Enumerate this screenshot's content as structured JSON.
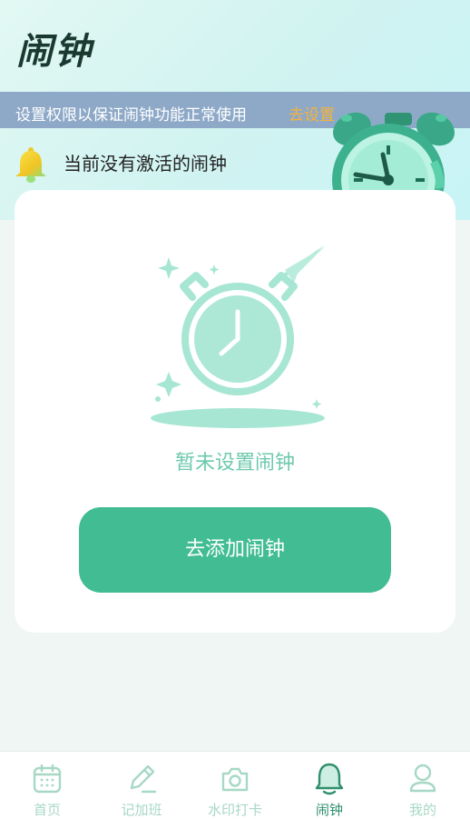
{
  "header": {
    "title": "闹钟"
  },
  "permission_bar": {
    "message": "设置权限以保证闹钟功能正常使用",
    "action": "去设置"
  },
  "status": {
    "text": "当前没有激活的闹钟",
    "icon": "bell-icon"
  },
  "empty_state": {
    "text": "暂未设置闹钟",
    "icon": "alarm-clock-illustration"
  },
  "add_button": {
    "label": "去添加闹钟"
  },
  "tabbar": {
    "items": [
      {
        "label": "首页",
        "icon": "calendar-icon",
        "active": false
      },
      {
        "label": "记加班",
        "icon": "pencil-icon",
        "active": false
      },
      {
        "label": "水印打卡",
        "icon": "camera-icon",
        "active": false
      },
      {
        "label": "闹钟",
        "icon": "bell-icon",
        "active": true
      },
      {
        "label": "我的",
        "icon": "user-icon",
        "active": false
      }
    ]
  },
  "colors": {
    "accent": "#42bd93",
    "permission_bar_bg": "#8ea9c8",
    "link": "#f5b23a",
    "tab_inactive": "#a7d8c5",
    "tab_active": "#2f8f6c"
  }
}
